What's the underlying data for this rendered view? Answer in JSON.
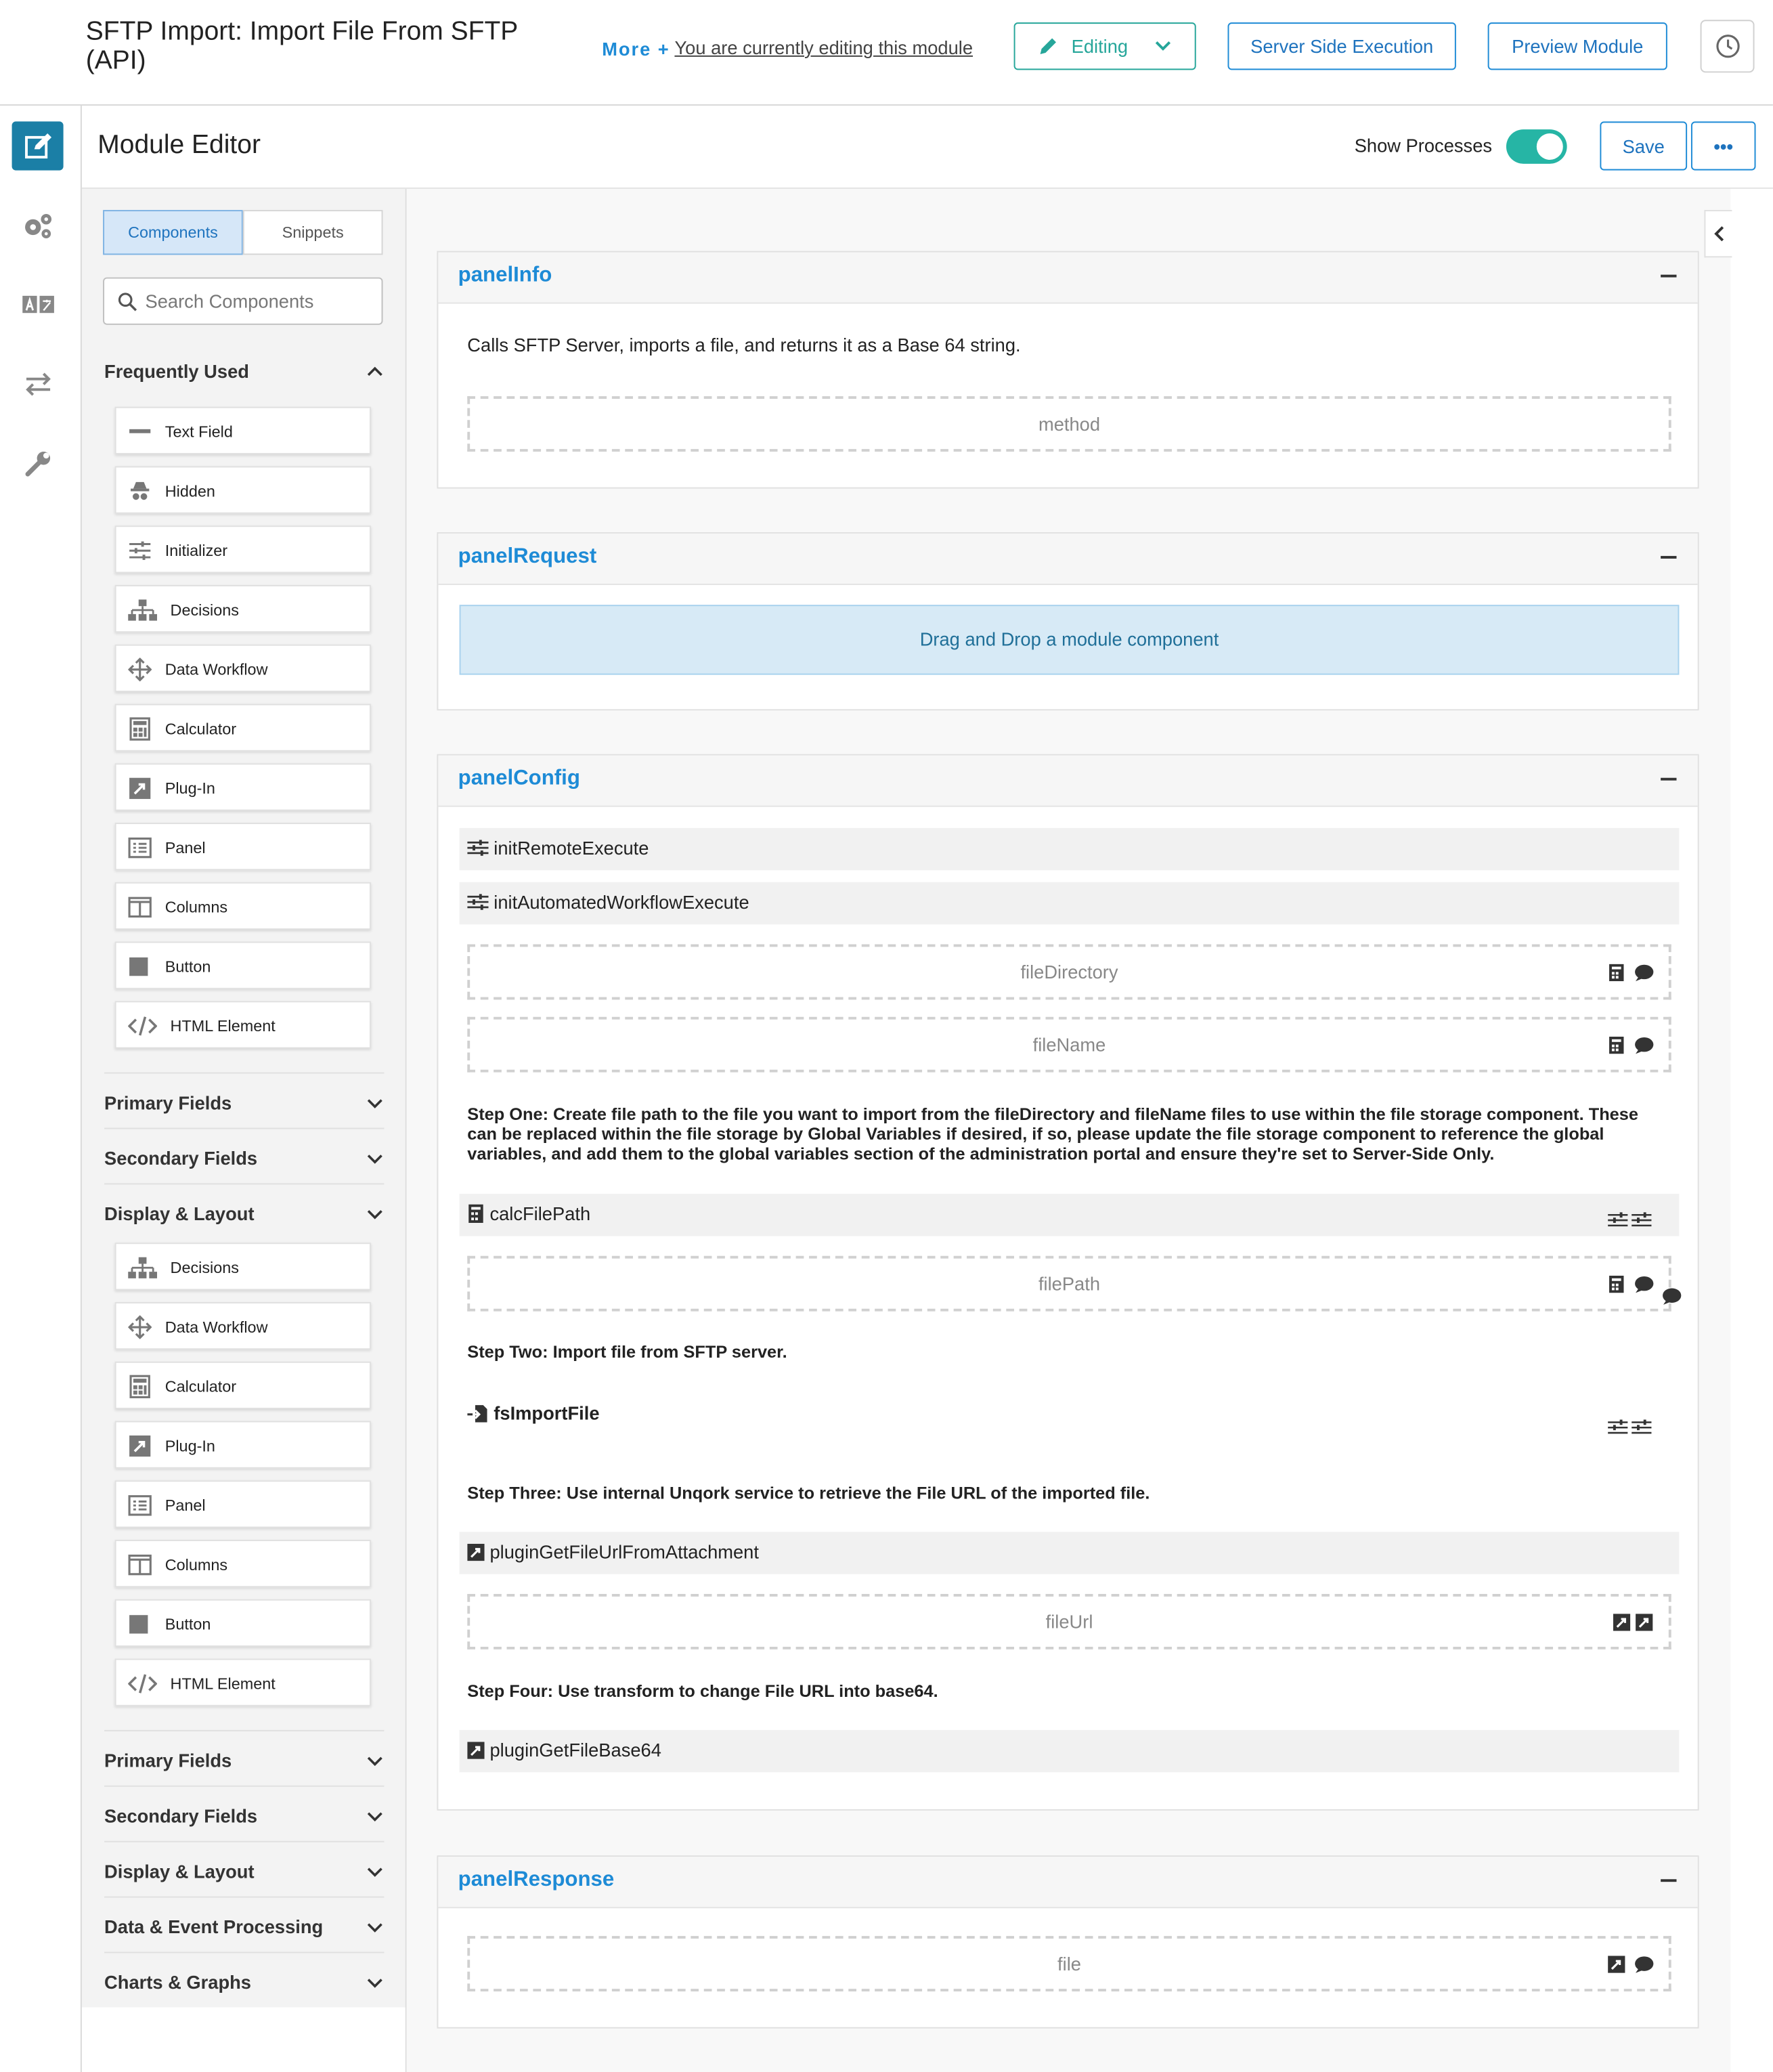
{
  "header": {
    "title": "SFTP Import: Import File From SFTP (API)",
    "more_label": "More +",
    "editing_note": "You are currently editing this module",
    "editing_button": "Editing",
    "server_side_button": "Server Side Execution",
    "preview_button": "Preview Module",
    "accent_color": "#1e8bd6",
    "editing_color": "#26a69a"
  },
  "editor": {
    "title": "Module Editor",
    "show_processes_label": "Show Processes",
    "show_processes_on": true,
    "save_label": "Save",
    "more_options_label": "•••"
  },
  "sidebar": {
    "tabs": [
      "Components",
      "Snippets"
    ],
    "active_tab": "Components",
    "search_placeholder": "Search Components",
    "frequently_used": {
      "title": "Frequently Used",
      "items": [
        {
          "label": "Text Field",
          "icon": "text-field-icon"
        },
        {
          "label": "Hidden",
          "icon": "hidden-icon"
        },
        {
          "label": "Initializer",
          "icon": "initializer-icon"
        },
        {
          "label": "Decisions",
          "icon": "decisions-icon"
        },
        {
          "label": "Data Workflow",
          "icon": "data-workflow-icon"
        },
        {
          "label": "Calculator",
          "icon": "calculator-icon"
        },
        {
          "label": "Plug-In",
          "icon": "plugin-icon"
        },
        {
          "label": "Panel",
          "icon": "panel-icon"
        },
        {
          "label": "Columns",
          "icon": "columns-icon"
        },
        {
          "label": "Button",
          "icon": "button-icon"
        },
        {
          "label": "HTML Element",
          "icon": "html-element-icon"
        }
      ]
    },
    "section_primary": "Primary Fields",
    "section_secondary": "Secondary Fields",
    "section_display": "Display & Layout",
    "display_items": [
      {
        "label": "Decisions",
        "icon": "decisions-icon"
      },
      {
        "label": "Data Workflow",
        "icon": "data-workflow-icon"
      },
      {
        "label": "Calculator",
        "icon": "calculator-icon"
      },
      {
        "label": "Plug-In",
        "icon": "plugin-icon"
      },
      {
        "label": "Panel",
        "icon": "panel-icon"
      },
      {
        "label": "Columns",
        "icon": "columns-icon"
      },
      {
        "label": "Button",
        "icon": "button-icon"
      },
      {
        "label": "HTML Element",
        "icon": "html-element-icon"
      }
    ],
    "bottom_sections": [
      "Primary Fields",
      "Secondary Fields",
      "Display & Layout",
      "Data & Event Processing",
      "Charts & Graphs"
    ]
  },
  "canvas": {
    "panel_info": {
      "name": "panelInfo",
      "description": "Calls SFTP Server, imports a file, and returns it as a Base 64 string.",
      "field_method": "method"
    },
    "panel_request": {
      "name": "panelRequest",
      "drop_text": "Drag and Drop a module component"
    },
    "panel_config": {
      "name": "panelConfig",
      "init_remote": "initRemoteExecute",
      "init_automated": "initAutomatedWorkflowExecute",
      "field_file_directory": "fileDirectory",
      "field_file_name": "fileName",
      "step_one": "Step One: Create file path to the file you want to import from the fileDirectory and fileName files to use within the file storage component. These can be replaced within the file storage by Global Variables if desired, if so, please update the file storage component to reference the global variables, and add them to the global variables section of the administration portal and ensure they're set to Server-Side Only.",
      "calc_file_path": "calcFilePath",
      "field_file_path": "filePath",
      "step_two": "Step Two: Import file from SFTP server.",
      "fs_import_file": "fsImportFile",
      "step_three": "Step Three: Use internal Unqork service to retrieve the File URL of the imported file.",
      "plugin_get_url": "pluginGetFileUrlFromAttachment",
      "field_file_url": "fileUrl",
      "step_four": "Step Four: Use transform to change File URL into base64.",
      "plugin_get_base64": "pluginGetFileBase64"
    },
    "panel_response": {
      "name": "panelResponse",
      "field_file": "file"
    }
  }
}
